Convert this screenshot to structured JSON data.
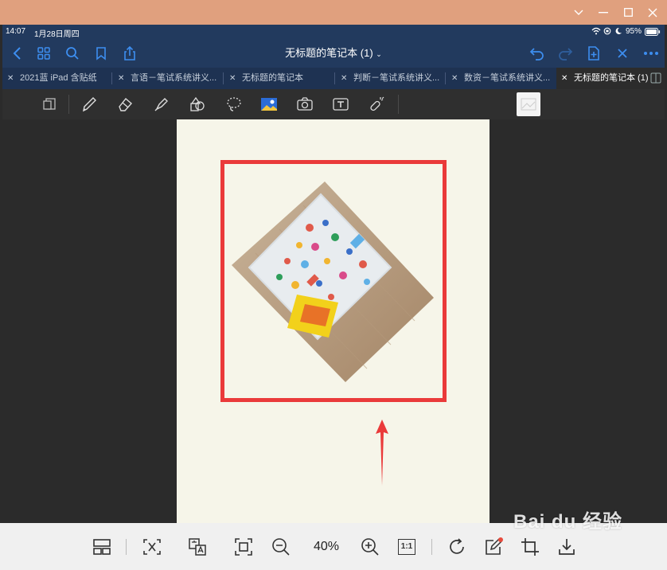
{
  "window": {
    "controls": [
      "minimize",
      "maximize",
      "close"
    ]
  },
  "status": {
    "time": "14:07",
    "date": "1月28日周四",
    "battery": "95%"
  },
  "header": {
    "title": "无标题的笔记本 (1)"
  },
  "tabs": [
    {
      "label": "2021蓝 iPad 含贴纸",
      "active": false
    },
    {
      "label": "言语－笔试系统讲义...",
      "active": false
    },
    {
      "label": "无标题的笔记本",
      "active": false
    },
    {
      "label": "判断－笔试系统讲义...",
      "active": false
    },
    {
      "label": "数资－笔试系统讲义...",
      "active": false
    },
    {
      "label": "无标题的笔记本 (1)",
      "active": true
    }
  ],
  "toolbar": {
    "tools": [
      "page-icon",
      "pen-icon",
      "eraser-icon",
      "highlighter-icon",
      "shapes-icon",
      "lasso-icon",
      "image-icon",
      "camera-icon",
      "text-icon",
      "laser-pointer-icon"
    ]
  },
  "viewer": {
    "zoom": "40%",
    "one_to_one": "1:1"
  },
  "watermark": {
    "text": "Bai du 经验"
  },
  "colors": {
    "accent": "#ea3a3a",
    "nav": "#223a5e",
    "page": "#f6f5e9"
  }
}
